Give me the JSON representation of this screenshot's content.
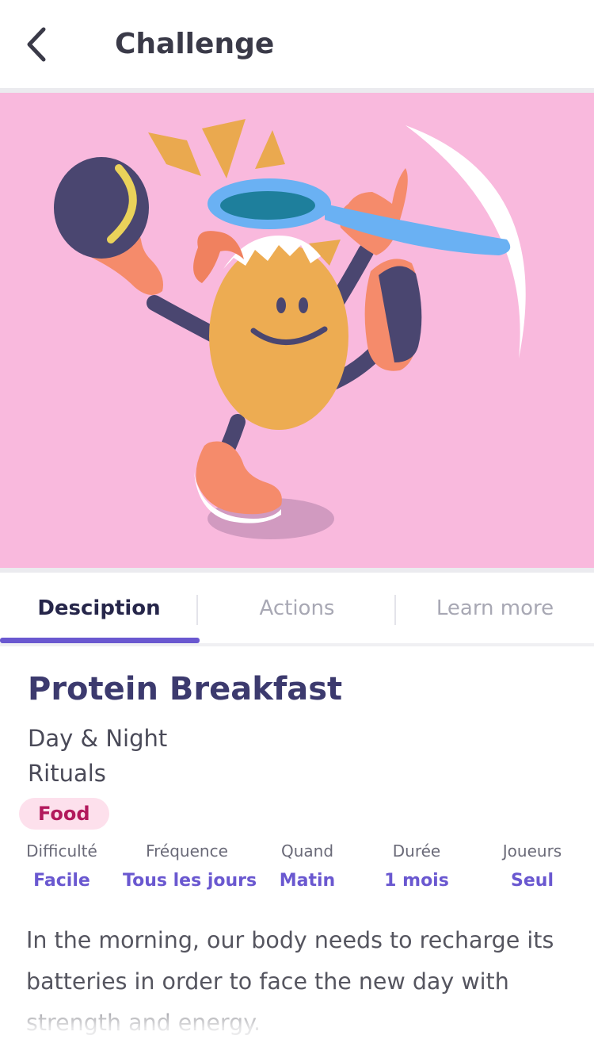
{
  "header": {
    "back_icon": "chevron-left-icon",
    "title": "Challenge"
  },
  "hero": {
    "illustration": "dancing-egg-with-spoon-and-hat",
    "background_color": "#f9b9dd"
  },
  "tabs": [
    {
      "label": "Desciption",
      "active": true
    },
    {
      "label": "Actions",
      "active": false
    },
    {
      "label": "Learn more",
      "active": false
    }
  ],
  "challenge": {
    "title": "Protein Breakfast",
    "category_line1": "Day & Night",
    "category_line2": "Rituals",
    "tag": "Food"
  },
  "meta": [
    {
      "label": "Difficulté",
      "value": "Facile"
    },
    {
      "label": "Fréquence",
      "value": "Tous les jours"
    },
    {
      "label": "Quand",
      "value": "Matin"
    },
    {
      "label": "Durée",
      "value": "1 mois"
    },
    {
      "label": "Joueurs",
      "value": "Seul"
    }
  ],
  "description": "In the morning, our body needs to recharge its batteries in order to face the new day with strength and energy.",
  "colors": {
    "accent": "#6a58d0",
    "title": "#3c3a6e",
    "tag_bg": "#fde0ec",
    "tag_text": "#b2195c"
  }
}
